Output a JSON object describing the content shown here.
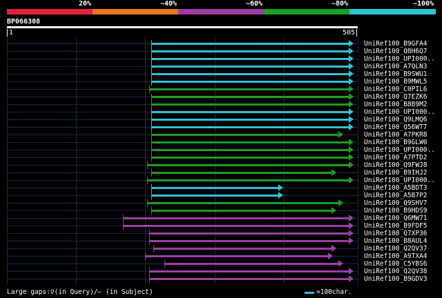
{
  "colors": {
    "red": "#e8203a",
    "orange": "#e87a1c",
    "purple": "#a03ca8",
    "green": "#1e9e1e",
    "cyan": "#2ec4d6",
    "bg": "#000000",
    "grid": "#1f2a3a"
  },
  "identity_scale": [
    {
      "label": "20%",
      "color": "#e8203a"
    },
    {
      "label": "~40%",
      "color": "#e87a1c"
    },
    {
      "label": "~60%",
      "color": "#a03ca8"
    },
    {
      "label": "~80%",
      "color": "#1e9e1e"
    },
    {
      "label": "~100%",
      "color": "#2ec4d6"
    }
  ],
  "query": {
    "name": "BP066308",
    "start": "1",
    "end": "505",
    "length": 505
  },
  "hits": [
    {
      "name": "UniRef100_B9GFA4",
      "color": "cyan",
      "start": 211,
      "end": 505
    },
    {
      "name": "UniRef100_Q8H6Q7",
      "color": "cyan",
      "start": 211,
      "end": 505
    },
    {
      "name": "UniRef100_UPI000..",
      "color": "cyan",
      "start": 211,
      "end": 505
    },
    {
      "name": "UniRef100_A7QLN3",
      "color": "cyan",
      "start": 211,
      "end": 505
    },
    {
      "name": "UniRef100_B9SWU1",
      "color": "cyan",
      "start": 211,
      "end": 505
    },
    {
      "name": "UniRef100_B9MWL5",
      "color": "cyan",
      "start": 211,
      "end": 505
    },
    {
      "name": "UniRef100_C0PIL6",
      "color": "green",
      "start": 208,
      "end": 505
    },
    {
      "name": "UniRef100_Q7EZK6",
      "color": "green",
      "start": 211,
      "end": 505
    },
    {
      "name": "UniRef100_B8B9M2",
      "color": "green",
      "start": 211,
      "end": 505
    },
    {
      "name": "UniRef100_UPI000..",
      "color": "cyan",
      "start": 211,
      "end": 505
    },
    {
      "name": "UniRef100_Q9LMQ6",
      "color": "cyan",
      "start": 211,
      "end": 505
    },
    {
      "name": "UniRef100_Q56WT7",
      "color": "cyan",
      "start": 211,
      "end": 505
    },
    {
      "name": "UniRef100_A7PKR8",
      "color": "green",
      "start": 211,
      "end": 490
    },
    {
      "name": "UniRef100_B9GLW0",
      "color": "green",
      "start": 211,
      "end": 505
    },
    {
      "name": "UniRef100_UPI000..",
      "color": "green",
      "start": 211,
      "end": 505
    },
    {
      "name": "UniRef100_A7PTD2",
      "color": "green",
      "start": 211,
      "end": 505
    },
    {
      "name": "UniRef100_Q9FWJ8",
      "color": "green",
      "start": 205,
      "end": 505
    },
    {
      "name": "UniRef100_B9IHJ2",
      "color": "green",
      "start": 211,
      "end": 480
    },
    {
      "name": "UniRef100_UPI000..",
      "color": "green",
      "start": 205,
      "end": 505
    },
    {
      "name": "UniRef100_A5BDT3",
      "color": "cyan",
      "start": 211,
      "end": 403
    },
    {
      "name": "UniRef100_A5B7P2",
      "color": "cyan",
      "start": 211,
      "end": 403
    },
    {
      "name": "UniRef100_Q9SHV7",
      "color": "green",
      "start": 205,
      "end": 490
    },
    {
      "name": "UniRef100_B9HDS9",
      "color": "green",
      "start": 211,
      "end": 480
    },
    {
      "name": "UniRef100_Q6MW71",
      "color": "purple",
      "start": 170,
      "end": 505
    },
    {
      "name": "UniRef100_B9FDF5",
      "color": "purple",
      "start": 170,
      "end": 505
    },
    {
      "name": "UniRef100_Q7XP36",
      "color": "purple",
      "start": 208,
      "end": 505
    },
    {
      "name": "UniRef100_B8AUL4",
      "color": "purple",
      "start": 208,
      "end": 505
    },
    {
      "name": "UniRef100_Q2QV37",
      "color": "purple",
      "start": 214,
      "end": 480
    },
    {
      "name": "UniRef100_A9TXA4",
      "color": "purple",
      "start": 202,
      "end": 475
    },
    {
      "name": "UniRef100_C5YBS6",
      "color": "purple",
      "start": 230,
      "end": 490
    },
    {
      "name": "UniRef100_Q2QV38",
      "color": "purple",
      "start": 208,
      "end": 505
    },
    {
      "name": "UniRef100_B9GDV3",
      "color": "purple",
      "start": 208,
      "end": 505
    }
  ],
  "footer": {
    "legend_text": "Large gaps:♀(in Query)/— (in Subject)",
    "scale_text": "=100char."
  }
}
